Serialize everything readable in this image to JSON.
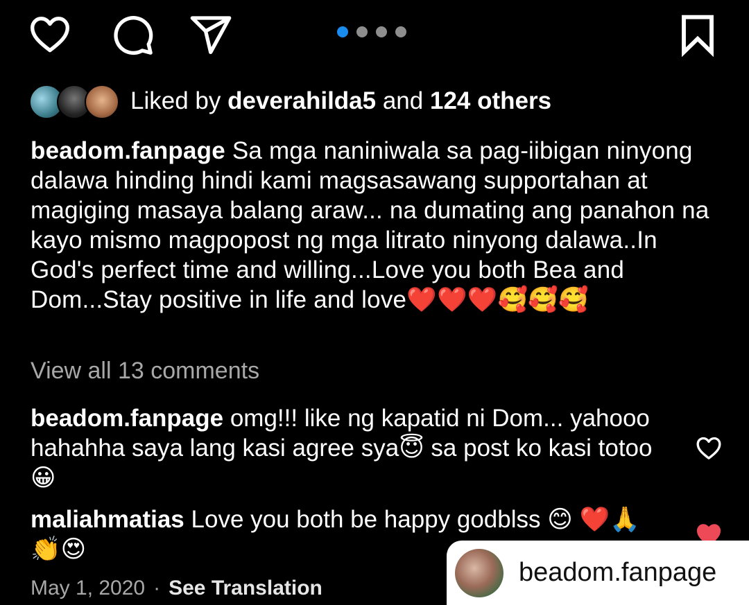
{
  "carousel": {
    "count": 4,
    "active_index": 0
  },
  "likes": {
    "prefix": "Liked by",
    "user": "deverahilda5",
    "middle": "and",
    "others": "124 others"
  },
  "caption": {
    "username": "beadom.fanpage",
    "text": "Sa mga naniniwala sa pag-iibigan ninyong dalawa hinding hindi kami magsasawang supportahan at magiging masaya balang araw... na dumating ang panahon na kayo mismo magpopost ng mga litrato ninyong dalawa..In God's perfect time and willing...Love you both Bea and Dom...Stay positive in life and love❤️❤️❤️🥰🥰🥰"
  },
  "view_all": "View all 13 comments",
  "comments": [
    {
      "username": "beadom.fanpage",
      "text": "omg!!! like ng kapatid ni Dom... yahooo hahahha saya lang kasi agree sya😇 sa post ko kasi totoo😀",
      "liked": false
    },
    {
      "username": "maliahmatias",
      "text": "Love you both be happy godblss 😊 ❤️🙏👏😍",
      "liked": true
    }
  ],
  "date": "May 1, 2020",
  "separator": "·",
  "see_translation": "See Translation",
  "repost": {
    "username": "beadom.fanpage"
  },
  "colors": {
    "background": "#000000",
    "active_dot": "#1a8cf0",
    "liked_heart": "#ed4956",
    "muted_text": "#a8a8a8"
  },
  "icons": [
    "heart-icon",
    "comment-icon",
    "share-icon",
    "bookmark-icon"
  ]
}
